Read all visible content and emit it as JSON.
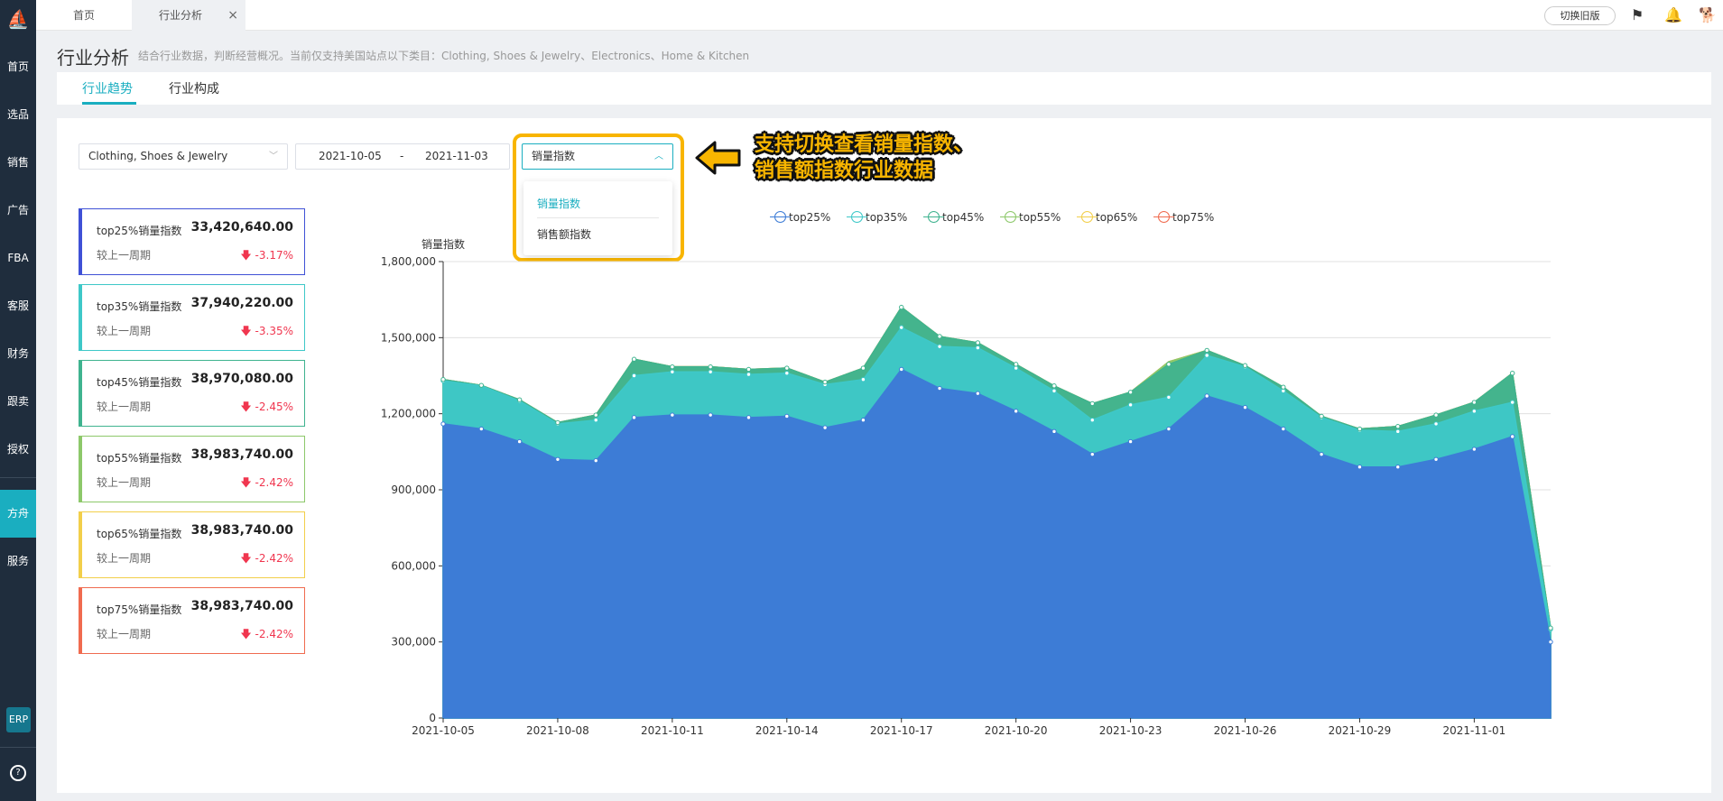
{
  "sidebar": {
    "items": [
      {
        "label": "首页"
      },
      {
        "label": "选品"
      },
      {
        "label": "销售"
      },
      {
        "label": "广告"
      },
      {
        "label": "FBA"
      },
      {
        "label": "客服"
      },
      {
        "label": "财务"
      },
      {
        "label": "跟卖"
      },
      {
        "label": "授权"
      },
      {
        "label": "方舟"
      },
      {
        "label": "服务"
      }
    ],
    "erp_label": "ERP",
    "active_item": "方舟"
  },
  "topbar": {
    "tabs": [
      {
        "label": "首页"
      },
      {
        "label": "行业分析"
      }
    ],
    "close_glyph": "×",
    "old_version_label": "切换旧版"
  },
  "header": {
    "title": "行业分析",
    "subtitle": "结合行业数据，判断经营概况。当前仅支持美国站点以下类目：Clothing, Shoes & Jewelry、Electronics、Home & Kitchen"
  },
  "subtabs": [
    {
      "label": "行业趋势"
    },
    {
      "label": "行业构成"
    }
  ],
  "filters": {
    "category": "Clothing, Shoes & Jewelry",
    "date_start": "2021-10-05",
    "date_separator": "-",
    "date_end": "2021-11-03",
    "metric": "销量指数",
    "metric_options": [
      "销量指数",
      "销售额指数"
    ]
  },
  "callout": {
    "line1": "支持切换查看销量指数、",
    "line2": "销售额指数行业数据"
  },
  "stats": [
    {
      "label": "top25%销量指数",
      "value": "33,420,640.00",
      "compare": "较上一周期",
      "change": "-3.17%",
      "color": "#3f51d6"
    },
    {
      "label": "top35%销量指数",
      "value": "37,940,220.00",
      "compare": "较上一周期",
      "change": "-3.35%",
      "color": "#3ec8c8"
    },
    {
      "label": "top45%销量指数",
      "value": "38,970,080.00",
      "compare": "较上一周期",
      "change": "-2.45%",
      "color": "#3fb38f"
    },
    {
      "label": "top55%销量指数",
      "value": "38,983,740.00",
      "compare": "较上一周期",
      "change": "-2.42%",
      "color": "#8dc86a"
    },
    {
      "label": "top65%销量指数",
      "value": "38,983,740.00",
      "compare": "较上一周期",
      "change": "-2.42%",
      "color": "#f2cf4a"
    },
    {
      "label": "top75%销量指数",
      "value": "38,983,740.00",
      "compare": "较上一周期",
      "change": "-2.42%",
      "color": "#f06b4f"
    }
  ],
  "chart_data": {
    "type": "area",
    "ylabel": "销量指数",
    "ylim": [
      0,
      1800000
    ],
    "yticks": [
      "0",
      "300,000",
      "600,000",
      "900,000",
      "1,200,000",
      "1,500,000",
      "1,800,000"
    ],
    "x": [
      "2021-10-05",
      "2021-10-06",
      "2021-10-07",
      "2021-10-08",
      "2021-10-09",
      "2021-10-10",
      "2021-10-11",
      "2021-10-12",
      "2021-10-13",
      "2021-10-14",
      "2021-10-15",
      "2021-10-16",
      "2021-10-17",
      "2021-10-18",
      "2021-10-19",
      "2021-10-20",
      "2021-10-21",
      "2021-10-22",
      "2021-10-23",
      "2021-10-24",
      "2021-10-25",
      "2021-10-26",
      "2021-10-27",
      "2021-10-28",
      "2021-10-29",
      "2021-10-30",
      "2021-10-31",
      "2021-11-01",
      "2021-11-02",
      "2021-11-03"
    ],
    "xtick_labels": [
      "2021-10-05",
      "2021-10-08",
      "2021-10-11",
      "2021-10-14",
      "2021-10-17",
      "2021-10-20",
      "2021-10-23",
      "2021-10-26",
      "2021-10-29",
      "2021-11-01"
    ],
    "grid": true,
    "legend_position": "top",
    "series": [
      {
        "name": "top25%",
        "color": "#3d7cd6",
        "values": [
          1160000,
          1140000,
          1090000,
          1020000,
          1015000,
          1185000,
          1195000,
          1195000,
          1185000,
          1190000,
          1145000,
          1175000,
          1375000,
          1300000,
          1280000,
          1210000,
          1130000,
          1040000,
          1090000,
          1140000,
          1270000,
          1225000,
          1140000,
          1040000,
          990000,
          990000,
          1020000,
          1060000,
          1110000,
          300000
        ]
      },
      {
        "name": "top35%",
        "color": "#3ec8c8",
        "values": [
          1330000,
          1310000,
          1250000,
          1160000,
          1175000,
          1350000,
          1365000,
          1365000,
          1355000,
          1360000,
          1315000,
          1335000,
          1540000,
          1465000,
          1460000,
          1380000,
          1290000,
          1175000,
          1235000,
          1265000,
          1430000,
          1385000,
          1290000,
          1185000,
          1135000,
          1130000,
          1160000,
          1210000,
          1245000,
          350000
        ]
      },
      {
        "name": "top45%",
        "color": "#3fb38f",
        "values": [
          1335000,
          1312000,
          1255000,
          1165000,
          1195000,
          1415000,
          1385000,
          1385000,
          1375000,
          1380000,
          1325000,
          1380000,
          1620000,
          1505000,
          1480000,
          1395000,
          1310000,
          1240000,
          1285000,
          1395000,
          1450000,
          1390000,
          1305000,
          1190000,
          1140000,
          1150000,
          1195000,
          1245000,
          1360000,
          355000
        ]
      },
      {
        "name": "top55%",
        "color": "#8dc86a",
        "values": [
          1335000,
          1312000,
          1255000,
          1165000,
          1195000,
          1415000,
          1385000,
          1385000,
          1375000,
          1380000,
          1325000,
          1380000,
          1620000,
          1505000,
          1480000,
          1395000,
          1310000,
          1240000,
          1285000,
          1405000,
          1450000,
          1390000,
          1305000,
          1190000,
          1140000,
          1150000,
          1195000,
          1245000,
          1360000,
          355000
        ]
      },
      {
        "name": "top65%",
        "color": "#f2cf4a",
        "values": [
          1335000,
          1312000,
          1255000,
          1165000,
          1195000,
          1415000,
          1385000,
          1385000,
          1375000,
          1380000,
          1325000,
          1380000,
          1620000,
          1505000,
          1480000,
          1395000,
          1310000,
          1240000,
          1285000,
          1405000,
          1450000,
          1390000,
          1305000,
          1190000,
          1140000,
          1150000,
          1195000,
          1245000,
          1360000,
          355000
        ]
      },
      {
        "name": "top75%",
        "color": "#f06b4f",
        "values": [
          1335000,
          1312000,
          1255000,
          1165000,
          1195000,
          1415000,
          1385000,
          1385000,
          1375000,
          1380000,
          1325000,
          1380000,
          1620000,
          1505000,
          1480000,
          1395000,
          1310000,
          1240000,
          1285000,
          1405000,
          1450000,
          1390000,
          1305000,
          1190000,
          1140000,
          1150000,
          1195000,
          1245000,
          1360000,
          355000
        ]
      }
    ]
  }
}
